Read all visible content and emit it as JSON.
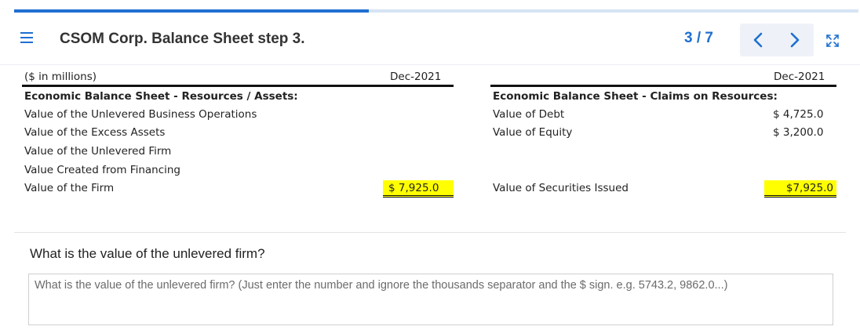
{
  "progress": {
    "fraction": 0.42
  },
  "header": {
    "title": "CSOM Corp. Balance Sheet step 3.",
    "pager": "3 / 7",
    "icons": {
      "menu": "hamburger-icon",
      "prev": "chevron-left-icon",
      "next": "chevron-right-icon",
      "expand": "expand-icon"
    },
    "accent_color": "#1f6fd1"
  },
  "sheet": {
    "units": "($ in millions)",
    "left_date": "Dec-2021",
    "right_date": "Dec-2021",
    "left_section": "Economic Balance Sheet - Resources / Assets:",
    "left_rows": [
      "Value of the Unlevered Business Operations",
      "Value of the Excess Assets",
      "Value of the Unlevered Firm",
      "Value Created from Financing",
      "Value of the Firm"
    ],
    "left_total": "$  7,925.0",
    "right_section": "Economic Balance Sheet - Claims on Resources:",
    "right_rows": [
      {
        "label": "Value of Debt",
        "value": "$  4,725.0"
      },
      {
        "label": "Value of Equity",
        "value": "$  3,200.0"
      }
    ],
    "right_total_label": "Value of Securities Issued",
    "right_total": "$7,925.0",
    "highlight_color": "#ffff00"
  },
  "question": {
    "text": "What is the value of the unlevered firm?",
    "placeholder": "What is the value of the unlevered firm? (Just enter the number and ignore the thousands separator and the $ sign. e.g. 5743.2, 9862.0...)"
  }
}
